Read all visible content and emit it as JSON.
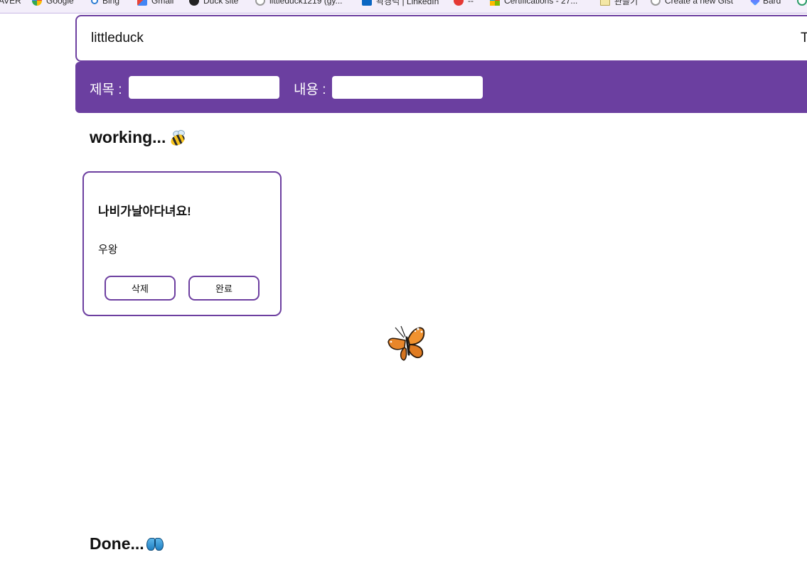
{
  "bookmarks": [
    {
      "label": "AVER",
      "icon": "naver-icon"
    },
    {
      "label": "Google",
      "icon": "google-icon"
    },
    {
      "label": "Bing",
      "icon": "bing-icon"
    },
    {
      "label": "Gmail",
      "icon": "gmail-icon"
    },
    {
      "label": "Duck site",
      "icon": "duck-icon"
    },
    {
      "label": "littleduck1219 (gy...",
      "icon": "github-icon"
    },
    {
      "label": "곽경덕 | LinkedIn",
      "icon": "linkedin-icon"
    },
    {
      "label": "--",
      "icon": "red-circle-icon"
    },
    {
      "label": "Certifications - 27...",
      "icon": "microsoft-icon"
    },
    {
      "label": "관들기",
      "icon": "document-icon"
    },
    {
      "label": "Create a new Gist",
      "icon": "github-icon"
    },
    {
      "label": "Bard",
      "icon": "bard-icon"
    }
  ],
  "header": {
    "title": "littleduck",
    "right_text": "T"
  },
  "form": {
    "title_label": "제목 :",
    "title_value": "",
    "content_label": "내용 :",
    "content_value": ""
  },
  "sections": {
    "working_title": "working...",
    "done_title": "Done..."
  },
  "todos_working": [
    {
      "title": "나비가날아다녀요!",
      "body": "우왕",
      "delete_label": "삭제",
      "complete_label": "완료"
    }
  ],
  "colors": {
    "accent": "#6b3fa0",
    "border": "#6d3fa0",
    "background": "#ffffff"
  }
}
